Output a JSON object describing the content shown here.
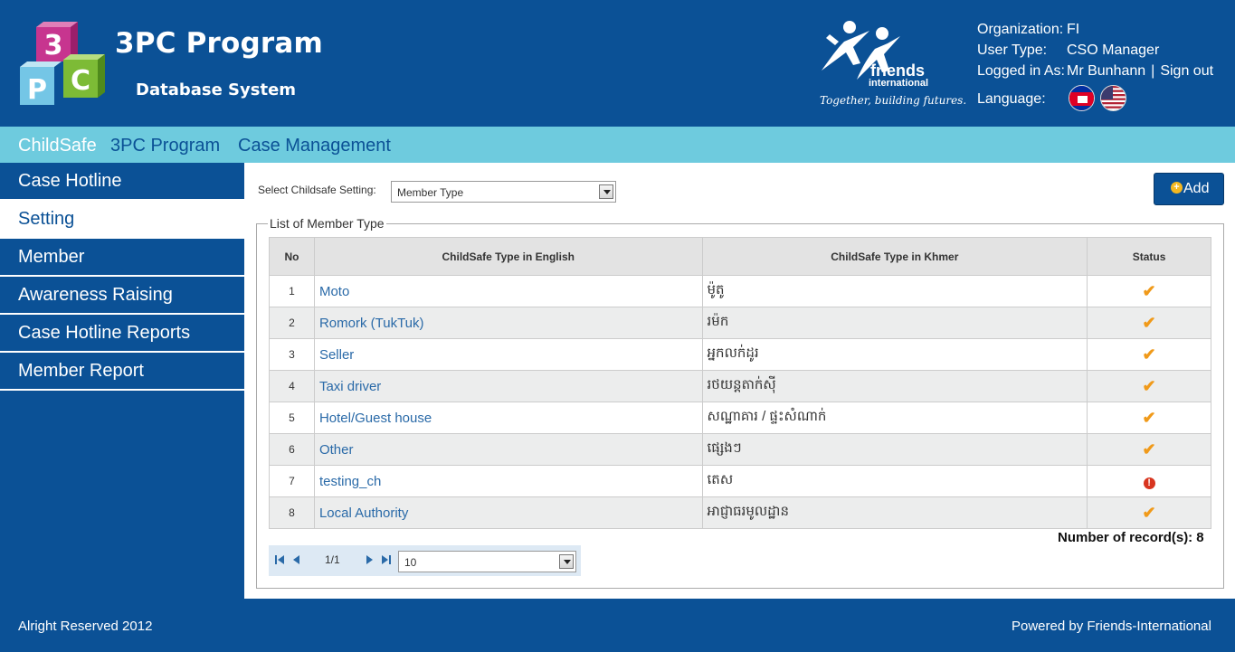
{
  "brand": {
    "title": "3PC Program",
    "subtitle": "Database System",
    "logo_letters": [
      "3",
      "P",
      "C"
    ]
  },
  "partner": {
    "name_line1": "friends",
    "name_line2": "international",
    "tagline": "Together, building futures."
  },
  "user": {
    "organization_label": "Organization:",
    "organization_value": "FI",
    "user_type_label": "User Type:",
    "user_type_value": "CSO Manager",
    "logged_in_label": "Logged in As:",
    "logged_in_value": "Mr Bunhann",
    "separator": "|",
    "sign_out": "Sign out",
    "language_label": "Language:"
  },
  "topnav": [
    "ChildSafe",
    "3PC Program",
    "Case Management"
  ],
  "sidebar": [
    {
      "label": "Case Hotline"
    },
    {
      "label": "Setting"
    },
    {
      "label": "Member"
    },
    {
      "label": "Awareness Raising"
    },
    {
      "label": "Case Hotline Reports"
    },
    {
      "label": "Member Report"
    }
  ],
  "setting": {
    "select_label": "Select Childsafe Setting:",
    "select_value": "Member Type",
    "add_label": "Add",
    "list_title": "List of Member Type"
  },
  "table": {
    "headers": [
      "No",
      "ChildSafe Type in English",
      "ChildSafe Type in Khmer",
      "Status"
    ],
    "rows": [
      {
        "no": "1",
        "en": "Moto",
        "kh": "ម៉ូតូ",
        "status": "active"
      },
      {
        "no": "2",
        "en": "Romork (TukTuk)",
        "kh": "រម៉ក",
        "status": "active"
      },
      {
        "no": "3",
        "en": "Seller",
        "kh": "អ្នកលក់ដូរ",
        "status": "active"
      },
      {
        "no": "4",
        "en": "Taxi driver",
        "kh": "រថយន្តតាក់ស៊ី",
        "status": "active"
      },
      {
        "no": "5",
        "en": "Hotel/Guest house",
        "kh": "សណ្ឋាគារ / ផ្ទះសំណាក់",
        "status": "active"
      },
      {
        "no": "6",
        "en": "Other",
        "kh": "ផ្សេងៗ",
        "status": "active"
      },
      {
        "no": "7",
        "en": "testing_ch",
        "kh": "តេស",
        "status": "inactive"
      },
      {
        "no": "8",
        "en": "Local Authority",
        "kh": "អាជ្ញាធរមូលដ្ឋាន",
        "status": "active"
      }
    ],
    "status_icons": {
      "active": "checkmark-icon",
      "inactive": "alert-icon"
    }
  },
  "records": {
    "label": "Number of record(s):",
    "value": "8"
  },
  "pager": {
    "page_text": "1/1",
    "page_size": "10"
  },
  "footer": {
    "left": "Alright Reserved 2012",
    "right": "Powered by Friends-International"
  },
  "colors": {
    "primary": "#0b5196",
    "nav_bar": "#6ecbde",
    "check": "#f09a1a",
    "alert": "#d8351f"
  }
}
